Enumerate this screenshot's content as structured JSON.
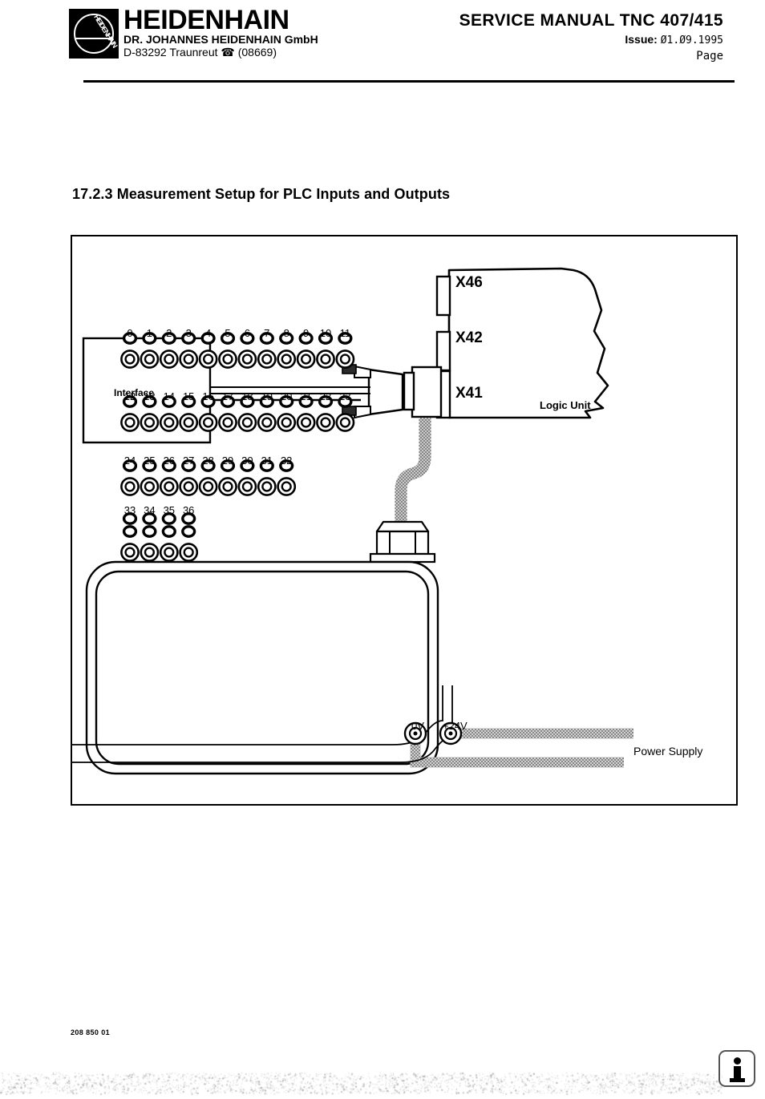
{
  "header": {
    "brand_name": "HEIDENHAIN",
    "brand_company": "DR. JOHANNES  HEIDENHAIN  GmbH",
    "brand_address": "D-83292 Traunreut ☎ (08669)",
    "logo_mark_text": "HEIDENHAIN",
    "doc_title": "SERVICE MANUAL TNC 407/415",
    "issue_label": "Issue:",
    "issue_date": "Ø1.Ø9.1995",
    "page_label": "Page",
    "page_number": ""
  },
  "section": {
    "heading": "17.2.3 Measurement Setup for PLC Inputs and Outputs"
  },
  "diagram": {
    "interface_label": "Interface",
    "logic_unit_label": "Logic Unit",
    "connectors": [
      {
        "id": "X46",
        "label": "X46"
      },
      {
        "id": "X42",
        "label": "X42"
      },
      {
        "id": "X41",
        "label": "X41"
      }
    ],
    "power_supply_label": "Power Supply",
    "terminal_0v_label": "0V",
    "terminal_24v_label": "+24V",
    "socket_rows": [
      {
        "row": 1,
        "numbers": [
          "0",
          "1",
          "2",
          "3",
          "4",
          "5",
          "6",
          "7",
          "8",
          "9",
          "10",
          "11"
        ],
        "style": "single-oval"
      },
      {
        "row": 2,
        "numbers": [
          "12",
          "13",
          "14",
          "15",
          "16",
          "17",
          "18",
          "19",
          "20",
          "21",
          "22",
          "23"
        ],
        "style": "single-oval"
      },
      {
        "row": 3,
        "numbers": [
          "24",
          "25",
          "26",
          "27",
          "28",
          "29",
          "30",
          "31",
          "32"
        ],
        "style": "single-oval"
      },
      {
        "row": 4,
        "numbers": [
          "33",
          "34",
          "35",
          "36"
        ],
        "style": "double-oval"
      }
    ]
  },
  "footer": {
    "doc_code": "208 850 01",
    "info_icon": "info-icon"
  },
  "colors": {
    "ink": "#000000",
    "cable_grey": "#9a9a9a",
    "badge_border": "#555555"
  }
}
